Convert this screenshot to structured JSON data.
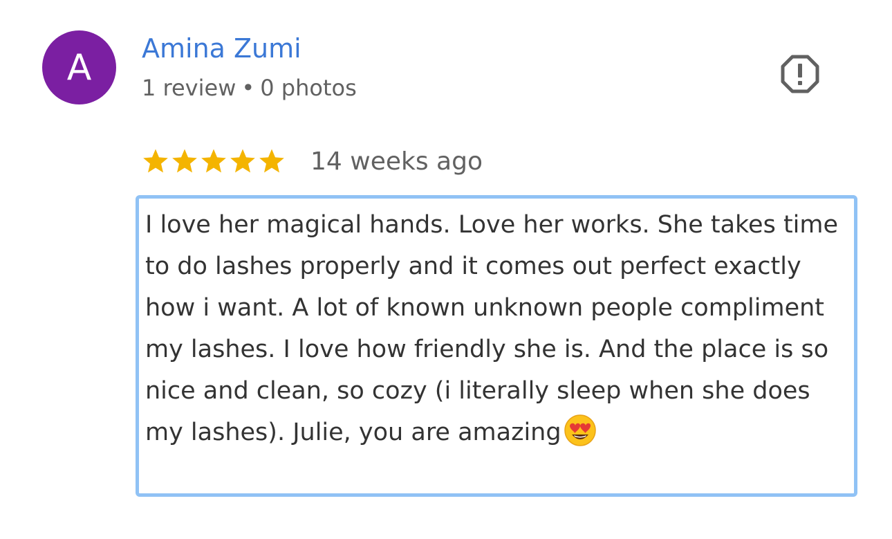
{
  "reviewer": {
    "initial": "A",
    "avatar_color": "#7b1fa2",
    "name": "Amina Zumi",
    "review_count": "1 review",
    "separator": "•",
    "photo_count": "0 photos"
  },
  "flag": {
    "icon": "report-icon"
  },
  "rating": {
    "stars": 5,
    "max_stars": 5,
    "star_color": "#f4b400",
    "date": "14 weeks ago"
  },
  "review": {
    "text": "I love her magical hands. Love her works. She takes time to do lashes properly and it comes out perfect exactly how i want. A lot of known unknown people compliment my lashes. I love how friendly she is. And the place is so nice and clean, so cozy (i literally sleep when she does my lashes). Julie, you are amazing",
    "emoji": "heart-eyes-emoji",
    "highlight_color": "#90c2f5"
  }
}
